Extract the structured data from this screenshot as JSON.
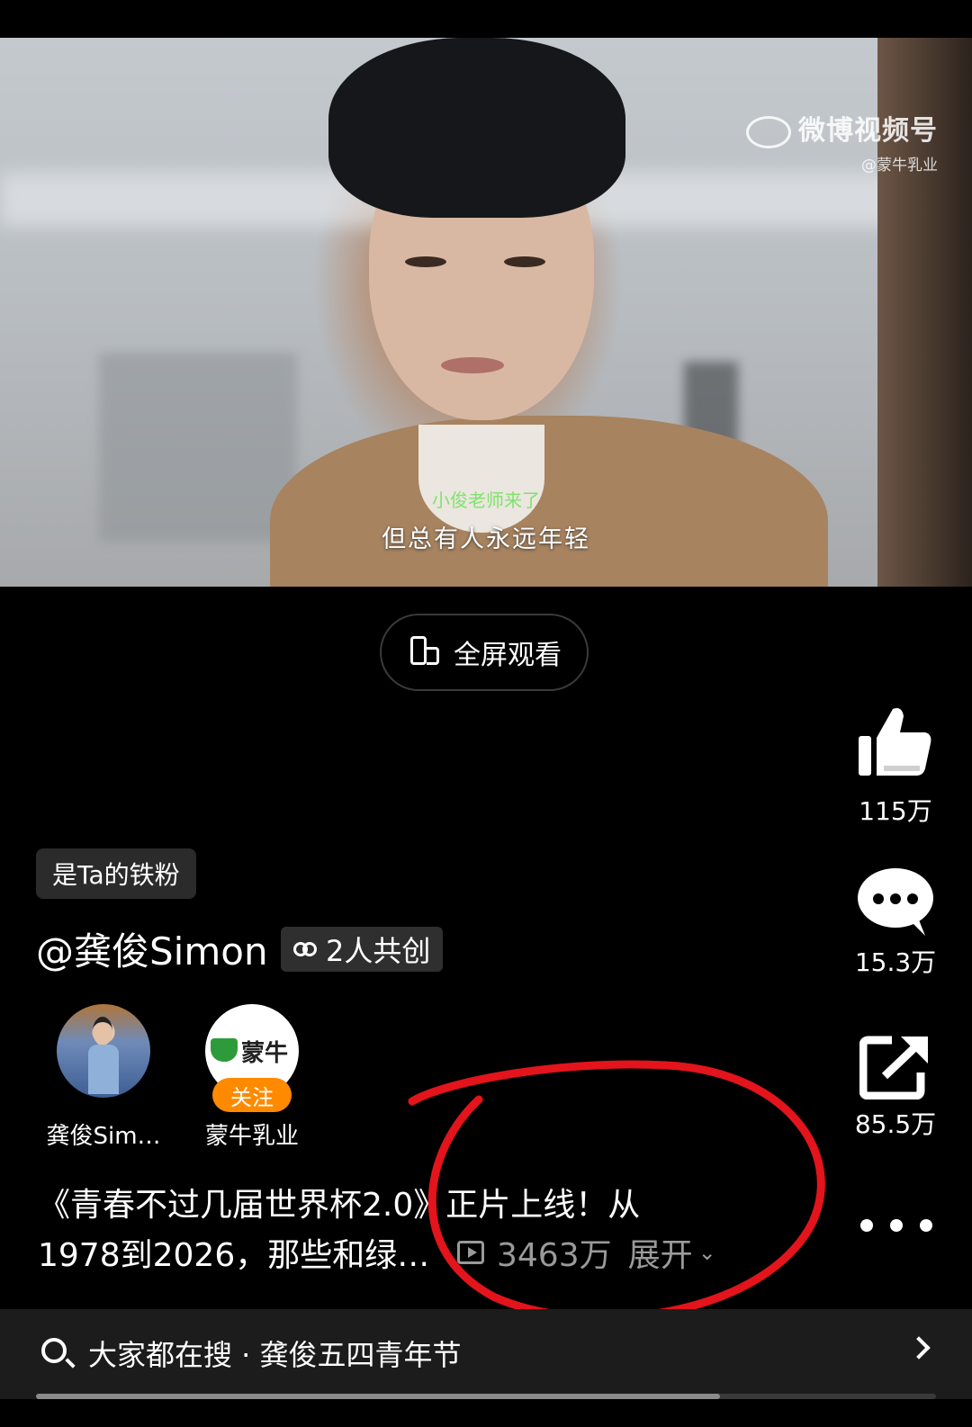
{
  "watermark": {
    "title": "微博视频号",
    "account": "@蒙牛乳业"
  },
  "subtitles": {
    "line1": "小俊老师来了",
    "line2": "但总有人永远年轻"
  },
  "fullscreen_label": "全屏观看",
  "actions": {
    "like_count": "115万",
    "comment_count": "15.3万",
    "share_count": "85.5万"
  },
  "fan_tag": "是Ta的铁粉",
  "author": "@龚俊Simon",
  "cocreate_label": "2人共创",
  "creators": [
    {
      "name": "龚俊Sim…"
    },
    {
      "name": "蒙牛乳业",
      "brand": "蒙牛",
      "follow_label": "关注"
    }
  ],
  "description": {
    "line1": "《青春不过几届世界杯2.0》正片上线！从",
    "line2": "1978到2026，那些和绿…",
    "views": "3463万",
    "expand": "展开"
  },
  "search": {
    "text": "大家都在搜 · 龚俊五四青年节"
  },
  "playback_progress": 0.76,
  "colors": {
    "follow": "#ff8a00",
    "annotation": "#e3141b",
    "subtitle_green": "#7fe36d"
  }
}
